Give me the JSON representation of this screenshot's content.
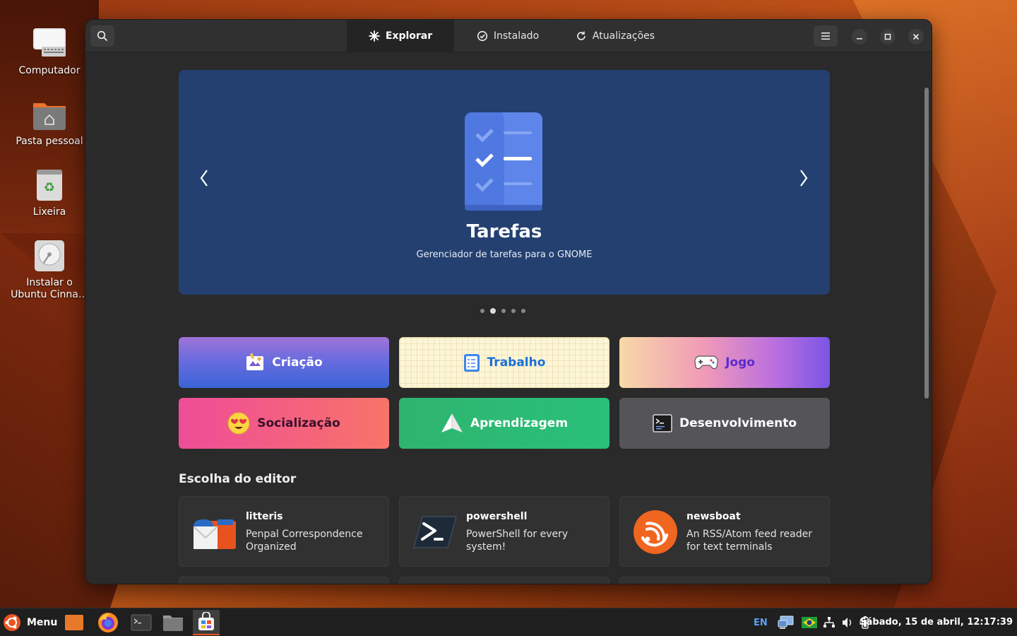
{
  "desktop": {
    "icons": [
      {
        "label": "Computador"
      },
      {
        "label": "Pasta pessoal"
      },
      {
        "label": "Lixeira"
      },
      {
        "label": "Instalar o Ubuntu Cinna…"
      }
    ]
  },
  "header": {
    "tabs": [
      {
        "label": "Explorar",
        "icon": "explore-icon"
      },
      {
        "label": "Instalado",
        "icon": "check-circle-icon"
      },
      {
        "label": "Atualizações",
        "icon": "refresh-icon"
      }
    ]
  },
  "banner": {
    "title": "Tarefas",
    "subtitle": "Gerenciador de tarefas para o GNOME",
    "page_count": 5,
    "active_page": 2,
    "color": "#234070"
  },
  "categories": [
    {
      "label": "Criação",
      "icon": "creation-icon"
    },
    {
      "label": "Trabalho",
      "icon": "work-icon"
    },
    {
      "label": "Jogo",
      "icon": "gamepad-icon"
    },
    {
      "label": "Socialização",
      "icon": "emoji-icon"
    },
    {
      "label": "Aprendizagem",
      "icon": "paper-plane-icon"
    },
    {
      "label": "Desenvolvimento",
      "icon": "terminal-icon"
    }
  ],
  "editors_choice": {
    "title": "Escolha do editor",
    "apps": [
      {
        "name": "litteris",
        "description": "Penpal Correspondence Organized"
      },
      {
        "name": "powershell",
        "description": "PowerShell for every system!"
      },
      {
        "name": "newsboat",
        "description": "An RSS/Atom feed reader for text terminals"
      }
    ]
  },
  "panel": {
    "menu_label": "Menu",
    "keyboard_layout": "EN",
    "clock": "Sábado, 15 de abril, 12:17:39"
  }
}
